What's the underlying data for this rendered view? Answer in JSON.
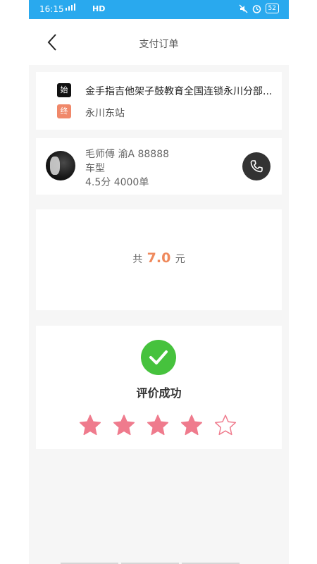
{
  "status_bar": {
    "time": "16:15",
    "network": "HD",
    "battery": "52"
  },
  "header": {
    "title": "支付订单"
  },
  "route": {
    "start_tag": "始",
    "start_place": "金手指吉他架子鼓教育全国连锁永川分部...",
    "end_tag": "终",
    "end_place": "永川东站"
  },
  "driver": {
    "name_plate": "毛师傅 渝A 88888",
    "car_type": "车型",
    "rating_orders": "4.5分 4000单"
  },
  "payment": {
    "prefix": "共",
    "amount": "7.0",
    "unit": "元"
  },
  "rating": {
    "message": "评价成功",
    "stars_filled": 4,
    "stars_total": 5,
    "star_color": "#ef7b8d"
  },
  "colors": {
    "status_bar": "#29a9ee",
    "success_green": "#46c23d",
    "amount_orange": "#ef8a5d",
    "end_tag": "#f0886a"
  }
}
